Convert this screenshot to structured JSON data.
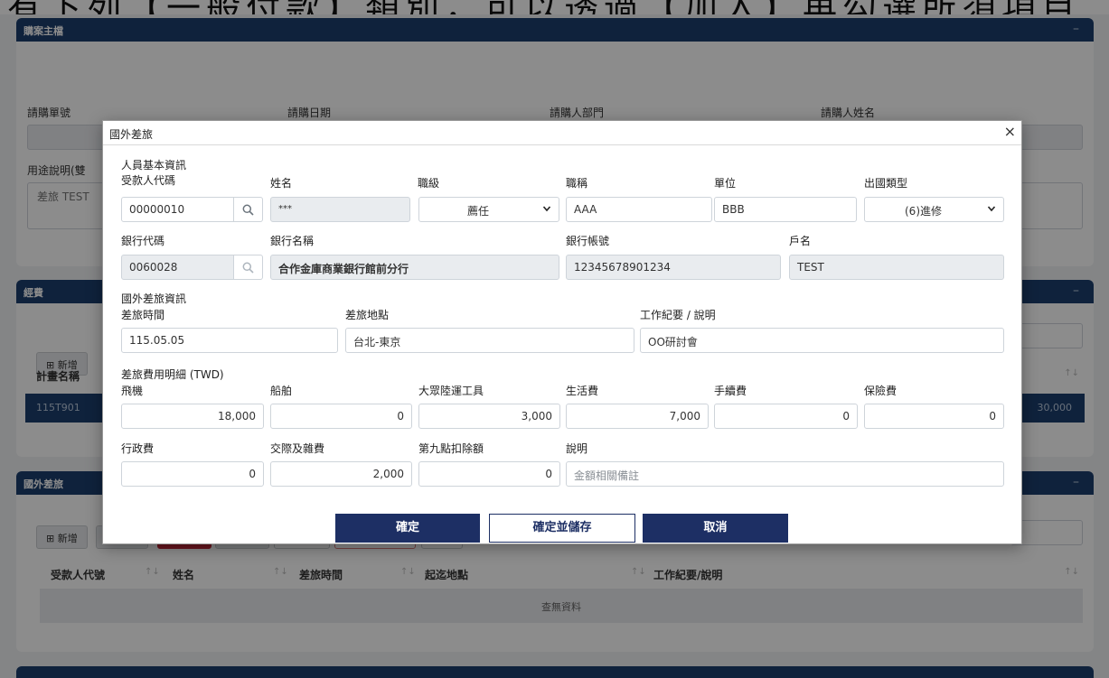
{
  "background": {
    "top_banner_text": "有下列【一般付款】類別，可以透過【加入】再勾選所須項目",
    "section_main": {
      "title": "購案主檔",
      "labels": {
        "req_no": "請購單號",
        "req_date": "請購日期",
        "req_dept": "請購人部門",
        "requester": "請購人姓名",
        "purpose": "用途說明(雙"
      },
      "purpose_value": "差旅 TEST"
    },
    "section_expense": {
      "title": "經費",
      "add_label": "新增",
      "col_plan": "計畫名稱",
      "row_code": "115T901",
      "row_amount": "30,000"
    },
    "section_travel": {
      "title": "國外差旅",
      "add_label": "新增",
      "columns": [
        "受款人代號",
        "姓名",
        "差旅時間",
        "起迄地點",
        "工作紀要/說明"
      ],
      "empty_text": "查無資料"
    }
  },
  "modal": {
    "title": "國外差旅",
    "close_label": "×",
    "basic_info": {
      "section_title": "人員基本資訊",
      "payee_code_label": "受款人代碼",
      "payee_code": "00000010",
      "name_label": "姓名",
      "name": "***",
      "rank_label": "職級",
      "rank": "薦任",
      "position_label": "職稱",
      "position": "AAA",
      "unit_label": "單位",
      "unit": "BBB",
      "trip_type_label": "出國類型",
      "trip_type": "(6)進修",
      "bank_code_label": "銀行代碼",
      "bank_code": "0060028",
      "bank_name_label": "銀行名稱",
      "bank_name": "合作金庫商業銀行館前分行",
      "account_label": "銀行帳號",
      "account": "12345678901234",
      "holder_label": "戶名",
      "holder": "TEST"
    },
    "travel_info": {
      "section_title": "國外差旅資訊",
      "time_label": "差旅時間",
      "time": "115.05.05",
      "place_label": "差旅地點",
      "place": "台北-東京",
      "desc_label": "工作紀要 / 說明",
      "desc": "OO研討會"
    },
    "expense": {
      "section_title": "差旅費用明細 (TWD)",
      "flight_label": "飛機",
      "flight": "18,000",
      "ship_label": "船舶",
      "ship": "0",
      "transit_label": "大眾陸運工具",
      "transit": "3,000",
      "living_label": "生活費",
      "living": "7,000",
      "fee_label": "手續費",
      "fee": "0",
      "insurance_label": "保險費",
      "insurance": "0",
      "admin_label": "行政費",
      "admin": "0",
      "social_label": "交際及雜費",
      "social": "2,000",
      "deduct_label": "第九點扣除額",
      "deduct": "0",
      "note_label": "說明",
      "note_placeholder": "金額相關備註"
    },
    "buttons": {
      "confirm": "確定",
      "confirm_save": "確定並儲存",
      "cancel": "取消"
    }
  },
  "colors": {
    "header_navy": "#1d3f6e",
    "button_navy": "#1d2f64",
    "readonly_bg": "#e9ecef"
  }
}
